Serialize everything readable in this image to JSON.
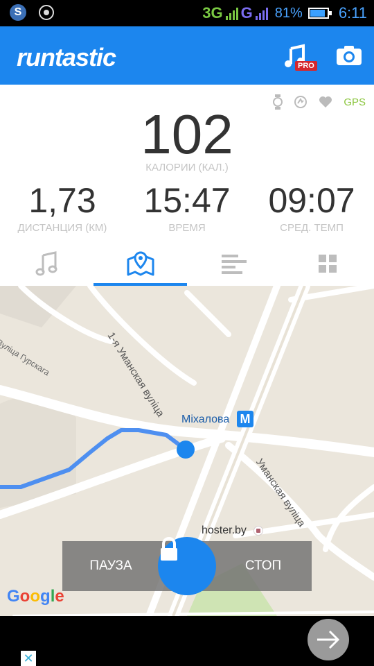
{
  "statusbar": {
    "network1": "3G",
    "network2": "G",
    "battery_pct": "81%",
    "time": "6:11"
  },
  "appbar": {
    "logo": "runtastic",
    "pro_badge": "PRO"
  },
  "indicators": {
    "gps": "GPS"
  },
  "stats": {
    "calories_value": "102",
    "calories_label": "КАЛОРИИ (КАЛ.)",
    "distance_value": "1,73",
    "distance_label": "ДИСТАНЦИЯ (КМ)",
    "time_value": "15:47",
    "time_label": "ВРЕМЯ",
    "pace_value": "09:07",
    "pace_label": "СРЕД. ТЕМП"
  },
  "tabs": [
    "music",
    "map",
    "stats",
    "dashboard"
  ],
  "active_tab": "map",
  "map": {
    "metro_station": "Міхалова",
    "metro_icon": "M",
    "poi": "hoster.by",
    "street_1": "1-я Уманская вуліца",
    "street_2": "Уманская вуліца",
    "street_3": "Вуліца Гурскага",
    "google": "Google"
  },
  "controls": {
    "pause": "ПАУЗА",
    "stop": "СТОП"
  },
  "colors": {
    "brand_blue": "#1c86ee",
    "gps_green": "#8cc63f",
    "map_bg": "#ebe6dc"
  }
}
